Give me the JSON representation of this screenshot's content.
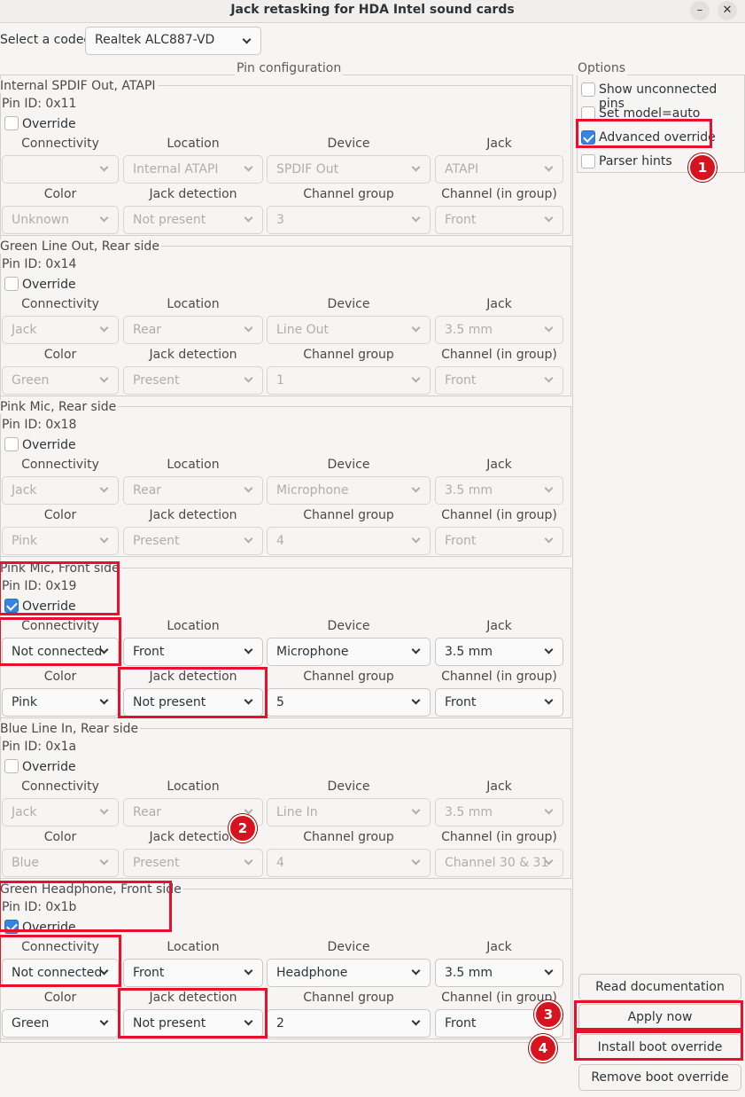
{
  "window": {
    "title": "Jack retasking for HDA Intel sound cards",
    "minimize_glyph": "–",
    "close_glyph": "✕"
  },
  "codec": {
    "label": "Select a codec:",
    "value": "Realtek ALC887-VD"
  },
  "pin_config": {
    "title": "Pin configuration"
  },
  "column_headers": {
    "connectivity": "Connectivity",
    "location": "Location",
    "device": "Device",
    "jack": "Jack",
    "color": "Color",
    "jack_detection": "Jack detection",
    "channel_group": "Channel group",
    "channel_in_group": "Channel (in group)"
  },
  "override_label": "Override",
  "pins": [
    {
      "title": "Internal SPDIF Out, ATAPI",
      "pin_id": "Pin ID: 0x11",
      "override": false,
      "connectivity": "",
      "location": "Internal ATAPI",
      "device": "SPDIF Out",
      "jack": "ATAPI",
      "color": "Unknown",
      "jack_detection": "Not present",
      "channel_group": "3",
      "channel_in_group": "Front"
    },
    {
      "title": "Green Line Out, Rear side",
      "pin_id": "Pin ID: 0x14",
      "override": false,
      "connectivity": "Jack",
      "location": "Rear",
      "device": "Line Out",
      "jack": "3.5 mm",
      "color": "Green",
      "jack_detection": "Present",
      "channel_group": "1",
      "channel_in_group": "Front"
    },
    {
      "title": "Pink Mic, Rear side",
      "pin_id": "Pin ID: 0x18",
      "override": false,
      "connectivity": "Jack",
      "location": "Rear",
      "device": "Microphone",
      "jack": "3.5 mm",
      "color": "Pink",
      "jack_detection": "Present",
      "channel_group": "4",
      "channel_in_group": "Front"
    },
    {
      "title": "Pink Mic, Front side",
      "pin_id": "Pin ID: 0x19",
      "override": true,
      "connectivity": "Not connected",
      "location": "Front",
      "device": "Microphone",
      "jack": "3.5 mm",
      "color": "Pink",
      "jack_detection": "Not present",
      "channel_group": "5",
      "channel_in_group": "Front"
    },
    {
      "title": "Blue Line In, Rear side",
      "pin_id": "Pin ID: 0x1a",
      "override": false,
      "connectivity": "Jack",
      "location": "Rear",
      "device": "Line In",
      "jack": "3.5 mm",
      "color": "Blue",
      "jack_detection": "Present",
      "channel_group": "4",
      "channel_in_group": "Channel 30 & 31"
    },
    {
      "title": "Green Headphone, Front side",
      "pin_id": "Pin ID: 0x1b",
      "override": true,
      "connectivity": "Not connected",
      "location": "Front",
      "device": "Headphone",
      "jack": "3.5 mm",
      "color": "Green",
      "jack_detection": "Not present",
      "channel_group": "2",
      "channel_in_group": "Front"
    }
  ],
  "options": {
    "title": "Options",
    "items": [
      {
        "label": "Show unconnected pins",
        "checked": false
      },
      {
        "label": "Set model=auto",
        "checked": false
      },
      {
        "label": "Advanced override",
        "checked": true
      },
      {
        "label": "Parser hints",
        "checked": false
      }
    ]
  },
  "buttons": {
    "read_docs": "Read documentation",
    "apply_now": "Apply now",
    "install_boot": "Install boot override",
    "remove_boot": "Remove boot override"
  },
  "badges": [
    "1",
    "2",
    "3",
    "4"
  ],
  "colors": {
    "annotation_red": "#e8112d",
    "badge_red": "#d7131f",
    "checkbox_blue": "#3584e4"
  }
}
